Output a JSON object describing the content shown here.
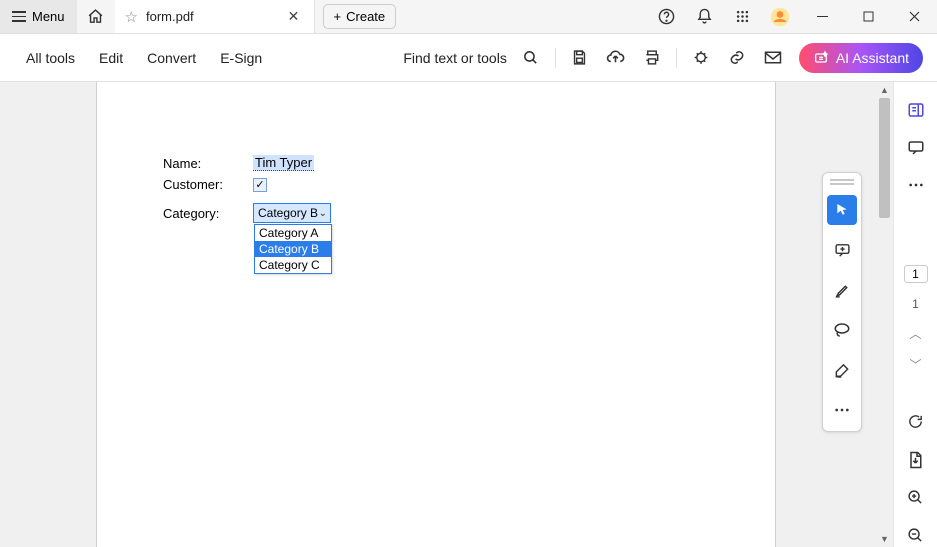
{
  "title_bar": {
    "menu_label": "Menu",
    "tab_title": "form.pdf",
    "create_label": "Create"
  },
  "toolbar": {
    "all_tools": "All tools",
    "edit": "Edit",
    "convert": "Convert",
    "esign": "E-Sign",
    "find_label": "Find text or tools",
    "ai_label": "AI Assistant"
  },
  "form": {
    "name_label": "Name:",
    "name_value": "Tim Typer",
    "customer_label": "Customer:",
    "customer_checked": "✓",
    "category_label": "Category:",
    "category_selected": "Category B",
    "category_options": [
      "Category A",
      "Category B",
      "Category C"
    ]
  },
  "pagination": {
    "current": "1",
    "total": "1"
  }
}
